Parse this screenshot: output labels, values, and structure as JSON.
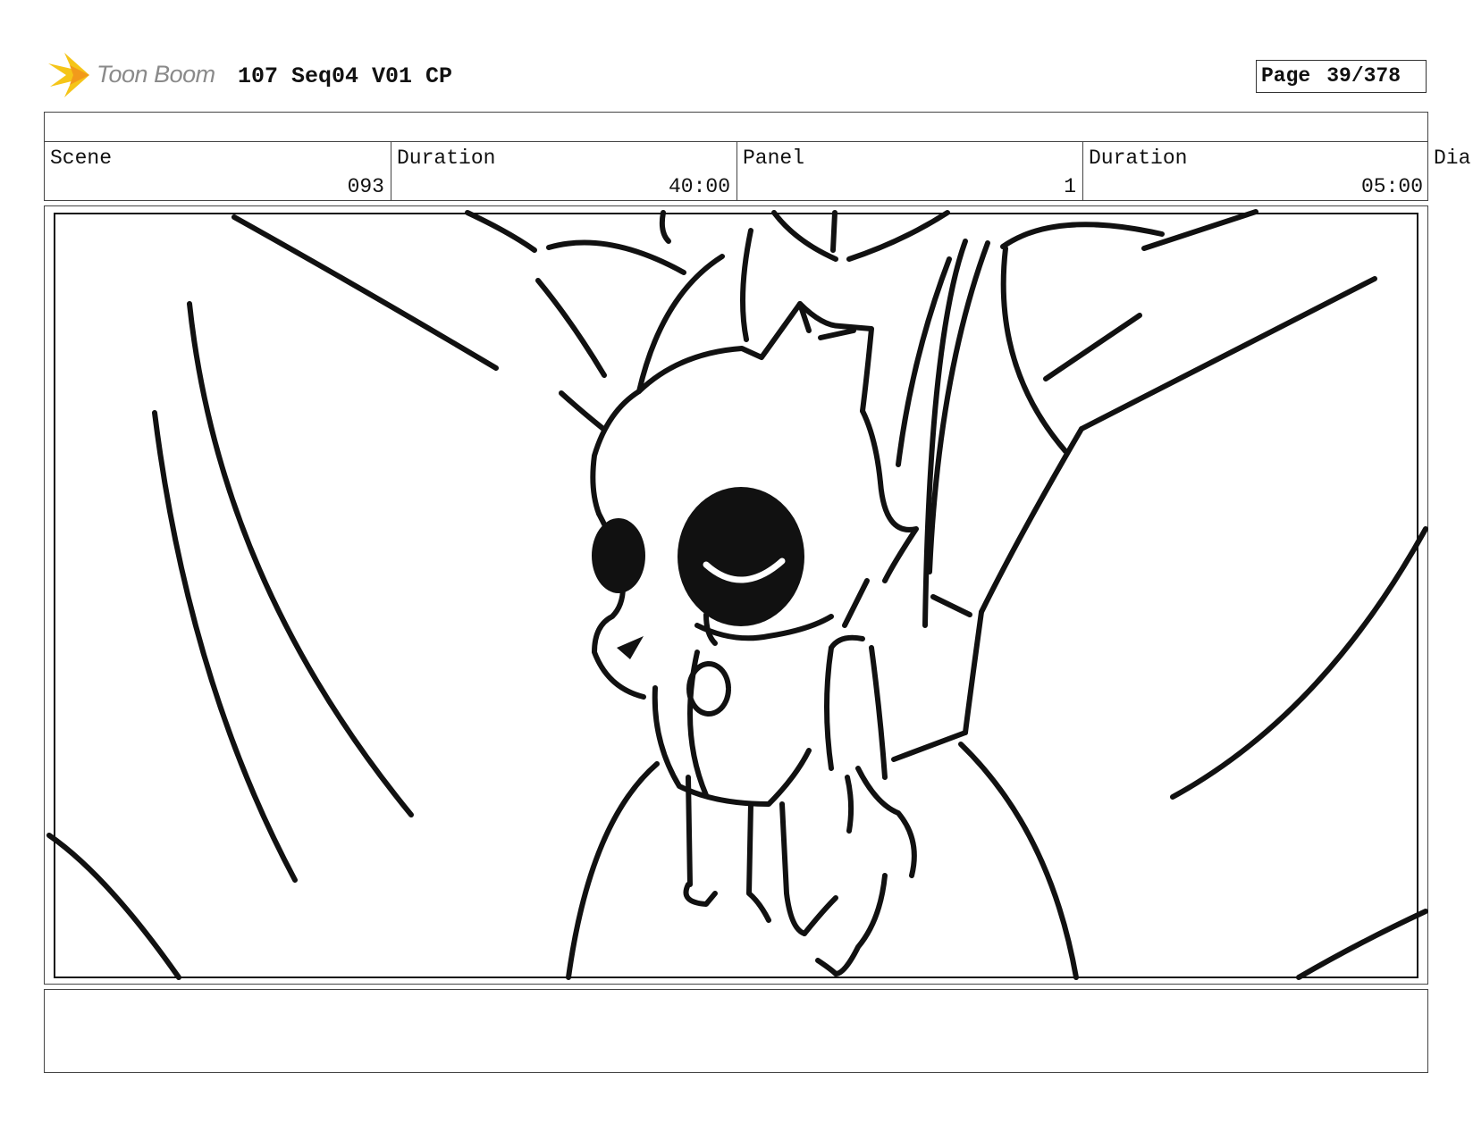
{
  "header": {
    "logo_text": "Toon Boom",
    "title": "107 Seq04 V01 CP",
    "page_label": "Page",
    "page_number": "39/378"
  },
  "fields": {
    "scene_label": "Scene",
    "scene_value": "093",
    "duration_label": "Duration",
    "duration_value": "40:00",
    "panel_label": "Panel",
    "panel_value": "1",
    "panel_duration_label": "Duration",
    "panel_duration_value": "05:00",
    "dialog_label_partial": "Dia"
  },
  "icons": {
    "logo": "toon-boom-star-logo-icon"
  },
  "colors": {
    "logo_yellow": "#f5c518",
    "logo_orange": "#f29a1b",
    "logo_gray": "#8a8a8a",
    "ink": "#111111"
  }
}
